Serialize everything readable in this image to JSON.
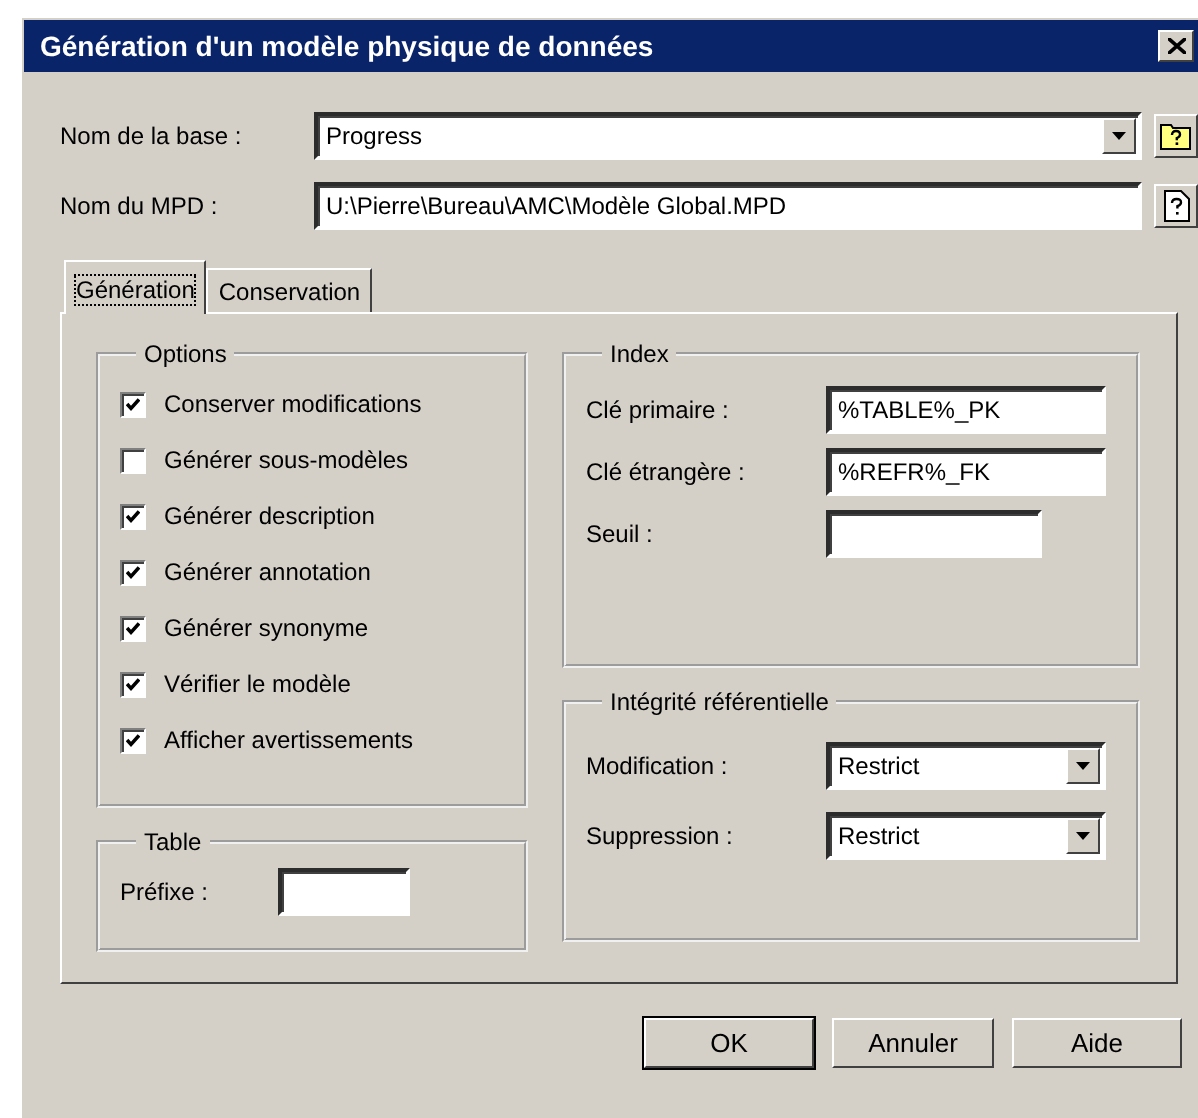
{
  "window": {
    "title": "Génération d'un modèle physique de données"
  },
  "database": {
    "label": "Nom de la base :",
    "value": "Progress"
  },
  "mpd": {
    "label": "Nom du MPD :",
    "value": "U:\\Pierre\\Bureau\\AMC\\Modèle Global.MPD"
  },
  "tabs": [
    {
      "label": "Génération",
      "selected": true
    },
    {
      "label": "Conservation",
      "selected": false
    }
  ],
  "options": {
    "title": "Options",
    "items": [
      {
        "label": "Conserver modifications",
        "checked": true
      },
      {
        "label": "Générer sous-modèles",
        "checked": false
      },
      {
        "label": "Générer description",
        "checked": true
      },
      {
        "label": "Générer annotation",
        "checked": true
      },
      {
        "label": "Générer synonyme",
        "checked": true
      },
      {
        "label": "Vérifier le modèle",
        "checked": true
      },
      {
        "label": "Afficher avertissements",
        "checked": true
      }
    ]
  },
  "table": {
    "title": "Table",
    "prefix_label": "Préfixe :"
  },
  "index": {
    "title": "Index",
    "fields": [
      {
        "label": "Clé primaire :",
        "value": "%TABLE%_PK"
      },
      {
        "label": "Clé étrangère :",
        "value": "%REFR%_FK"
      },
      {
        "label": "Seuil :"
      }
    ]
  },
  "integrity": {
    "title": "Intégrité référentielle",
    "fields": [
      {
        "label": "Modification :",
        "value": "Restrict"
      },
      {
        "label": "Suppression :",
        "value": "Restrict"
      }
    ]
  },
  "buttons": [
    {
      "label": "OK",
      "default": true
    },
    {
      "label": "Annuler",
      "default": false
    },
    {
      "label": "Aide",
      "default": false
    }
  ]
}
